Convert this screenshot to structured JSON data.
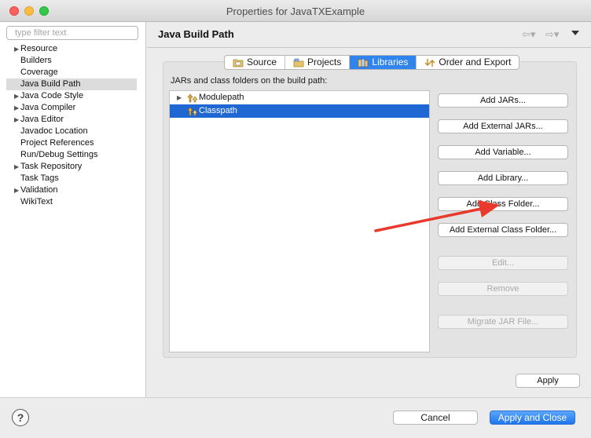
{
  "window": {
    "title": "Properties for JavaTXExample"
  },
  "sidebar": {
    "filter_placeholder": "type filter text",
    "items": [
      {
        "label": "Resource",
        "expandable": true
      },
      {
        "label": "Builders",
        "expandable": false
      },
      {
        "label": "Coverage",
        "expandable": false
      },
      {
        "label": "Java Build Path",
        "expandable": false,
        "selected": true
      },
      {
        "label": "Java Code Style",
        "expandable": true
      },
      {
        "label": "Java Compiler",
        "expandable": true
      },
      {
        "label": "Java Editor",
        "expandable": true
      },
      {
        "label": "Javadoc Location",
        "expandable": false
      },
      {
        "label": "Project References",
        "expandable": false
      },
      {
        "label": "Run/Debug Settings",
        "expandable": false
      },
      {
        "label": "Task Repository",
        "expandable": true
      },
      {
        "label": "Task Tags",
        "expandable": false
      },
      {
        "label": "Validation",
        "expandable": true
      },
      {
        "label": "WikiText",
        "expandable": false
      }
    ]
  },
  "page": {
    "title": "Java Build Path",
    "tabs": [
      {
        "label": "Source",
        "icon": "source-folder-icon"
      },
      {
        "label": "Projects",
        "icon": "projects-icon"
      },
      {
        "label": "Libraries",
        "icon": "libraries-icon",
        "active": true
      },
      {
        "label": "Order and Export",
        "icon": "order-export-icon"
      }
    ],
    "description": "JARs and class folders on the build path:",
    "tree": [
      {
        "label": "Modulepath",
        "selected": false
      },
      {
        "label": "Classpath",
        "selected": true
      }
    ],
    "buttons": {
      "add_jars": "Add JARs...",
      "add_external_jars": "Add External JARs...",
      "add_variable": "Add Variable...",
      "add_library": "Add Library...",
      "add_class_folder": "Add Class Folder...",
      "add_external_class_folder": "Add External Class Folder...",
      "edit": "Edit...",
      "remove": "Remove",
      "migrate_jar": "Migrate JAR File..."
    },
    "apply_label": "Apply"
  },
  "footer": {
    "help": "?",
    "cancel_label": "Cancel",
    "apply_close_label": "Apply and Close"
  },
  "colors": {
    "accent": "#2f84ee",
    "selection": "#1f67d2",
    "annotation_arrow": "#e8392c"
  }
}
